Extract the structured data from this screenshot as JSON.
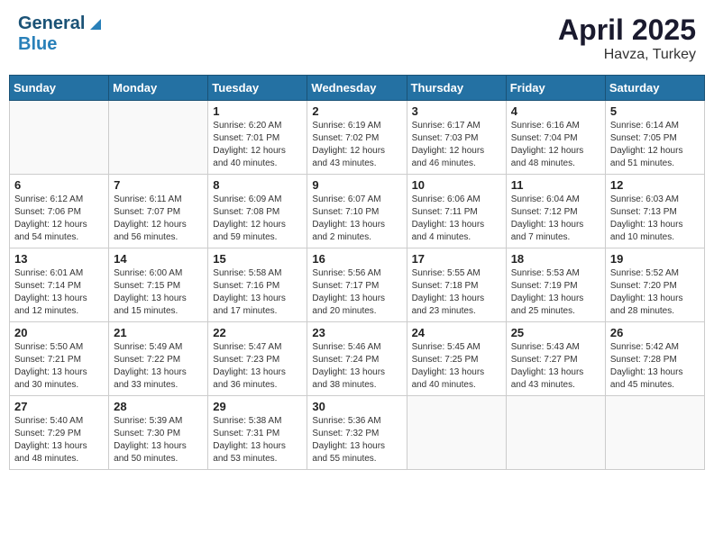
{
  "header": {
    "logo_general": "General",
    "logo_blue": "Blue",
    "title": "April 2025",
    "location": "Havza, Turkey"
  },
  "calendar": {
    "days_of_week": [
      "Sunday",
      "Monday",
      "Tuesday",
      "Wednesday",
      "Thursday",
      "Friday",
      "Saturday"
    ],
    "weeks": [
      [
        {
          "day": "",
          "info": ""
        },
        {
          "day": "",
          "info": ""
        },
        {
          "day": "1",
          "sunrise": "Sunrise: 6:20 AM",
          "sunset": "Sunset: 7:01 PM",
          "daylight": "Daylight: 12 hours and 40 minutes."
        },
        {
          "day": "2",
          "sunrise": "Sunrise: 6:19 AM",
          "sunset": "Sunset: 7:02 PM",
          "daylight": "Daylight: 12 hours and 43 minutes."
        },
        {
          "day": "3",
          "sunrise": "Sunrise: 6:17 AM",
          "sunset": "Sunset: 7:03 PM",
          "daylight": "Daylight: 12 hours and 46 minutes."
        },
        {
          "day": "4",
          "sunrise": "Sunrise: 6:16 AM",
          "sunset": "Sunset: 7:04 PM",
          "daylight": "Daylight: 12 hours and 48 minutes."
        },
        {
          "day": "5",
          "sunrise": "Sunrise: 6:14 AM",
          "sunset": "Sunset: 7:05 PM",
          "daylight": "Daylight: 12 hours and 51 minutes."
        }
      ],
      [
        {
          "day": "6",
          "sunrise": "Sunrise: 6:12 AM",
          "sunset": "Sunset: 7:06 PM",
          "daylight": "Daylight: 12 hours and 54 minutes."
        },
        {
          "day": "7",
          "sunrise": "Sunrise: 6:11 AM",
          "sunset": "Sunset: 7:07 PM",
          "daylight": "Daylight: 12 hours and 56 minutes."
        },
        {
          "day": "8",
          "sunrise": "Sunrise: 6:09 AM",
          "sunset": "Sunset: 7:08 PM",
          "daylight": "Daylight: 12 hours and 59 minutes."
        },
        {
          "day": "9",
          "sunrise": "Sunrise: 6:07 AM",
          "sunset": "Sunset: 7:10 PM",
          "daylight": "Daylight: 13 hours and 2 minutes."
        },
        {
          "day": "10",
          "sunrise": "Sunrise: 6:06 AM",
          "sunset": "Sunset: 7:11 PM",
          "daylight": "Daylight: 13 hours and 4 minutes."
        },
        {
          "day": "11",
          "sunrise": "Sunrise: 6:04 AM",
          "sunset": "Sunset: 7:12 PM",
          "daylight": "Daylight: 13 hours and 7 minutes."
        },
        {
          "day": "12",
          "sunrise": "Sunrise: 6:03 AM",
          "sunset": "Sunset: 7:13 PM",
          "daylight": "Daylight: 13 hours and 10 minutes."
        }
      ],
      [
        {
          "day": "13",
          "sunrise": "Sunrise: 6:01 AM",
          "sunset": "Sunset: 7:14 PM",
          "daylight": "Daylight: 13 hours and 12 minutes."
        },
        {
          "day": "14",
          "sunrise": "Sunrise: 6:00 AM",
          "sunset": "Sunset: 7:15 PM",
          "daylight": "Daylight: 13 hours and 15 minutes."
        },
        {
          "day": "15",
          "sunrise": "Sunrise: 5:58 AM",
          "sunset": "Sunset: 7:16 PM",
          "daylight": "Daylight: 13 hours and 17 minutes."
        },
        {
          "day": "16",
          "sunrise": "Sunrise: 5:56 AM",
          "sunset": "Sunset: 7:17 PM",
          "daylight": "Daylight: 13 hours and 20 minutes."
        },
        {
          "day": "17",
          "sunrise": "Sunrise: 5:55 AM",
          "sunset": "Sunset: 7:18 PM",
          "daylight": "Daylight: 13 hours and 23 minutes."
        },
        {
          "day": "18",
          "sunrise": "Sunrise: 5:53 AM",
          "sunset": "Sunset: 7:19 PM",
          "daylight": "Daylight: 13 hours and 25 minutes."
        },
        {
          "day": "19",
          "sunrise": "Sunrise: 5:52 AM",
          "sunset": "Sunset: 7:20 PM",
          "daylight": "Daylight: 13 hours and 28 minutes."
        }
      ],
      [
        {
          "day": "20",
          "sunrise": "Sunrise: 5:50 AM",
          "sunset": "Sunset: 7:21 PM",
          "daylight": "Daylight: 13 hours and 30 minutes."
        },
        {
          "day": "21",
          "sunrise": "Sunrise: 5:49 AM",
          "sunset": "Sunset: 7:22 PM",
          "daylight": "Daylight: 13 hours and 33 minutes."
        },
        {
          "day": "22",
          "sunrise": "Sunrise: 5:47 AM",
          "sunset": "Sunset: 7:23 PM",
          "daylight": "Daylight: 13 hours and 36 minutes."
        },
        {
          "day": "23",
          "sunrise": "Sunrise: 5:46 AM",
          "sunset": "Sunset: 7:24 PM",
          "daylight": "Daylight: 13 hours and 38 minutes."
        },
        {
          "day": "24",
          "sunrise": "Sunrise: 5:45 AM",
          "sunset": "Sunset: 7:25 PM",
          "daylight": "Daylight: 13 hours and 40 minutes."
        },
        {
          "day": "25",
          "sunrise": "Sunrise: 5:43 AM",
          "sunset": "Sunset: 7:27 PM",
          "daylight": "Daylight: 13 hours and 43 minutes."
        },
        {
          "day": "26",
          "sunrise": "Sunrise: 5:42 AM",
          "sunset": "Sunset: 7:28 PM",
          "daylight": "Daylight: 13 hours and 45 minutes."
        }
      ],
      [
        {
          "day": "27",
          "sunrise": "Sunrise: 5:40 AM",
          "sunset": "Sunset: 7:29 PM",
          "daylight": "Daylight: 13 hours and 48 minutes."
        },
        {
          "day": "28",
          "sunrise": "Sunrise: 5:39 AM",
          "sunset": "Sunset: 7:30 PM",
          "daylight": "Daylight: 13 hours and 50 minutes."
        },
        {
          "day": "29",
          "sunrise": "Sunrise: 5:38 AM",
          "sunset": "Sunset: 7:31 PM",
          "daylight": "Daylight: 13 hours and 53 minutes."
        },
        {
          "day": "30",
          "sunrise": "Sunrise: 5:36 AM",
          "sunset": "Sunset: 7:32 PM",
          "daylight": "Daylight: 13 hours and 55 minutes."
        },
        {
          "day": "",
          "info": ""
        },
        {
          "day": "",
          "info": ""
        },
        {
          "day": "",
          "info": ""
        }
      ]
    ]
  }
}
